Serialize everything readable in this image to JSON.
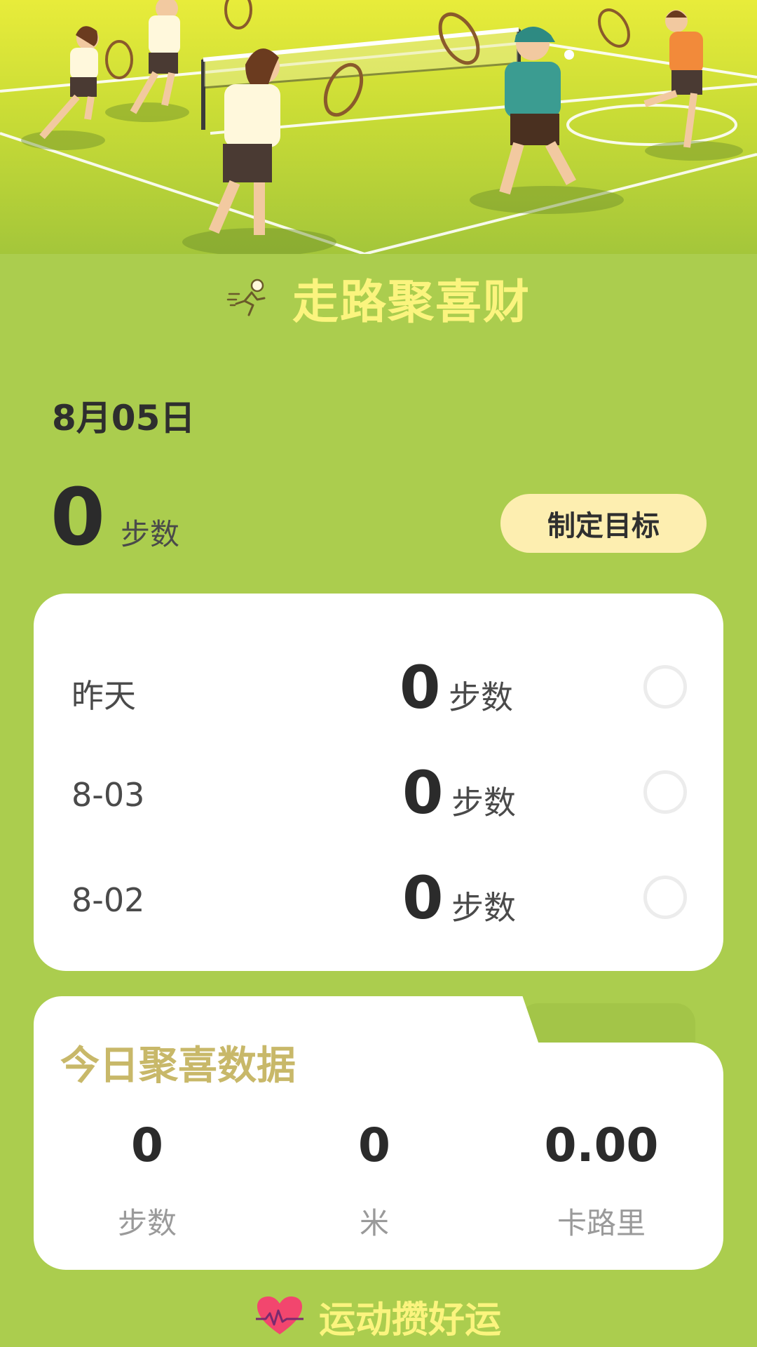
{
  "hero": {
    "icon": "badminton-players-illustration"
  },
  "header": {
    "title": "走路聚喜财",
    "icon": "runner-icon"
  },
  "today": {
    "date": "8月05日",
    "steps": "0",
    "steps_unit": "步数",
    "goal_button": "制定目标"
  },
  "history": [
    {
      "day": "昨天",
      "steps": "0",
      "unit": "步数"
    },
    {
      "day": "8-03",
      "steps": "0",
      "unit": "步数"
    },
    {
      "day": "8-02",
      "steps": "0",
      "unit": "步数"
    }
  ],
  "stats": {
    "heading": "今日聚喜数据",
    "items": [
      {
        "value": "0",
        "label": "步数"
      },
      {
        "value": "0",
        "label": "米"
      },
      {
        "value": "0.00",
        "label": "卡路里"
      }
    ]
  },
  "footer": {
    "text": "运动攒好运",
    "icon": "heart-pulse-icon"
  },
  "colors": {
    "background": "#abcd4e",
    "title": "#fbf47e",
    "goal_button": "#fdeeb0",
    "stats_heading": "#c8b869"
  }
}
